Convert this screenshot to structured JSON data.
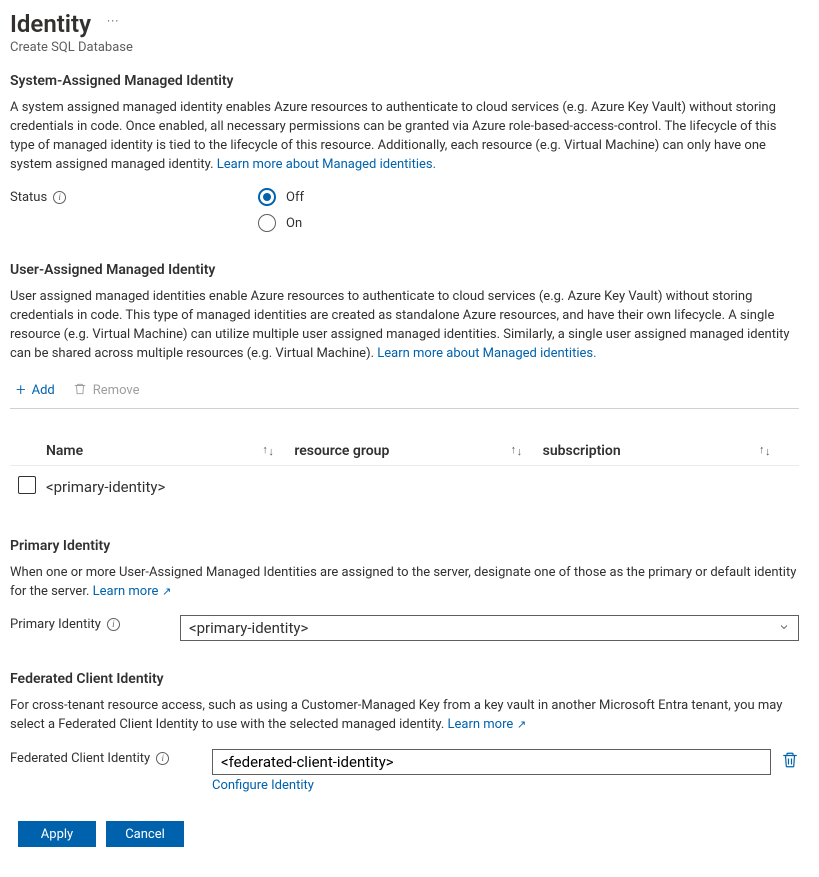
{
  "header": {
    "title": "Identity",
    "subtitle": "Create SQL Database"
  },
  "system_identity": {
    "heading": "System-Assigned Managed Identity",
    "description": "A system assigned managed identity enables Azure resources to authenticate to cloud services (e.g. Azure Key Vault) without storing credentials in code. Once enabled, all necessary permissions can be granted via Azure role-based-access-control. The lifecycle of this type of managed identity is tied to the lifecycle of this resource. Additionally, each resource (e.g. Virtual Machine) can only have one system assigned managed identity. ",
    "learn_more": "Learn more about Managed identities.",
    "status_label": "Status",
    "options": {
      "off": "Off",
      "on": "On"
    },
    "selected": "off"
  },
  "user_identity": {
    "heading": "User-Assigned Managed Identity",
    "description": "User assigned managed identities enable Azure resources to authenticate to cloud services (e.g. Azure Key Vault) without storing credentials in code. This type of managed identities are created as standalone Azure resources, and have their own lifecycle. A single resource (e.g. Virtual Machine) can utilize multiple user assigned managed identities. Similarly, a single user assigned managed identity can be shared across multiple resources (e.g. Virtual Machine). ",
    "learn_more": "Learn more about Managed identities.",
    "toolbar": {
      "add": "Add",
      "remove": "Remove"
    },
    "table": {
      "columns": {
        "name": "Name",
        "resource_group": "resource group",
        "subscription": "subscription"
      },
      "row1": {
        "name": "<primary-identity>"
      }
    }
  },
  "primary_identity": {
    "heading": "Primary Identity",
    "description": "When one or more User-Assigned Managed Identities are assigned to the server, designate one of those as the primary or default identity for the server. ",
    "learn_more": "Learn more",
    "label": "Primary Identity",
    "value": "<primary-identity>"
  },
  "federated": {
    "heading": "Federated Client Identity",
    "description": "For cross-tenant resource access, such as using a Customer-Managed Key from a key vault in another Microsoft Entra tenant, you may select a Federated Client Identity to use with the selected managed identity. ",
    "learn_more": "Learn more",
    "label": "Federated Client Identity",
    "value": "<federated-client-identity>",
    "configure": "Configure Identity"
  },
  "footer": {
    "apply": "Apply",
    "cancel": "Cancel"
  }
}
